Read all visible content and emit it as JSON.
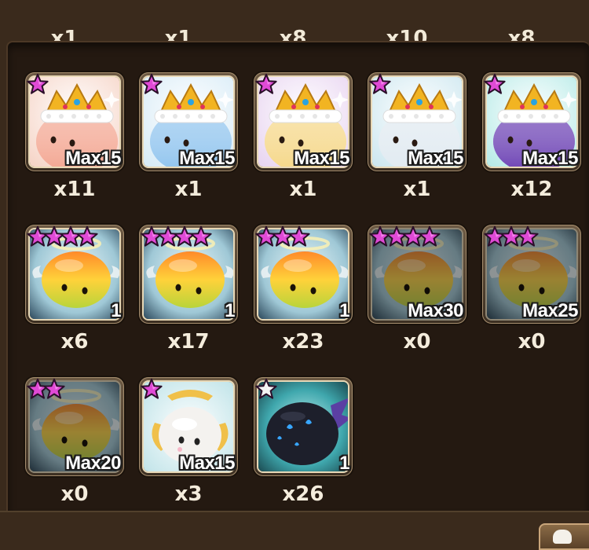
{
  "partial_counts": [
    "x1",
    "x1",
    "x8",
    "x10",
    "x8"
  ],
  "rows": [
    [
      {
        "name": "king-angelmon-fire",
        "stars": 1,
        "star_color": "pink",
        "level": "Max15",
        "qty": "x11",
        "dim": false,
        "kind": "king",
        "body": "#f3a48f",
        "bg": "#f6d6c9"
      },
      {
        "name": "king-angelmon-water",
        "stars": 1,
        "star_color": "pink",
        "level": "Max15",
        "qty": "x1",
        "dim": false,
        "kind": "king",
        "body": "#8ec3ee",
        "bg": "#d9ecf7"
      },
      {
        "name": "king-angelmon-light",
        "stars": 1,
        "star_color": "pink",
        "level": "Max15",
        "qty": "x1",
        "dim": false,
        "kind": "king",
        "body": "#f5d685",
        "bg": "#e9d6f1"
      },
      {
        "name": "king-angelmon-wind",
        "stars": 1,
        "star_color": "pink",
        "level": "Max15",
        "qty": "x1",
        "dim": false,
        "kind": "king",
        "body": "#dfe9f0",
        "bg": "#cfe8f0"
      },
      {
        "name": "king-angelmon-dark",
        "stars": 1,
        "star_color": "pink",
        "level": "Max15",
        "qty": "x12",
        "dim": false,
        "kind": "king",
        "body": "#6a3fb3",
        "bg": "#b9ebe8"
      }
    ],
    [
      {
        "name": "angelmon-4star",
        "stars": 4,
        "star_color": "pink",
        "level": "1",
        "qty": "x6",
        "dim": false,
        "kind": "angel",
        "body": "#f8c240",
        "bg": "#9fc8d6"
      },
      {
        "name": "angelmon-4star-b",
        "stars": 4,
        "star_color": "pink",
        "level": "1",
        "qty": "x17",
        "dim": false,
        "kind": "angel",
        "body": "#f8c240",
        "bg": "#9fc8d6"
      },
      {
        "name": "angelmon-3star",
        "stars": 3,
        "star_color": "pink",
        "level": "1",
        "qty": "x23",
        "dim": false,
        "kind": "angel",
        "body": "#f8c240",
        "bg": "#9fc8d6"
      },
      {
        "name": "angelmon-4star-empty",
        "stars": 4,
        "star_color": "pink",
        "level": "Max30",
        "qty": "x0",
        "dim": true,
        "kind": "angel",
        "body": "#f8c240",
        "bg": "#9fc8d6"
      },
      {
        "name": "angelmon-3star-empty",
        "stars": 3,
        "star_color": "pink",
        "level": "Max25",
        "qty": "x0",
        "dim": true,
        "kind": "angel",
        "body": "#f8c240",
        "bg": "#9fc8d6"
      }
    ],
    [
      {
        "name": "angelmon-2star-empty",
        "stars": 2,
        "star_color": "pink",
        "level": "Max20",
        "qty": "x0",
        "dim": true,
        "kind": "angel",
        "body": "#f8c240",
        "bg": "#9fc8d6"
      },
      {
        "name": "rainbowmon-white",
        "stars": 1,
        "star_color": "pink",
        "level": "Max15",
        "qty": "x3",
        "dim": false,
        "kind": "white",
        "body": "#f4f2ef",
        "bg": "#bfe3e8"
      },
      {
        "name": "devilmon",
        "stars": 1,
        "star_color": "white",
        "level": "1",
        "qty": "x26",
        "dim": false,
        "kind": "devil",
        "body": "#1d1f2b",
        "bg": "#3fa7ad"
      }
    ]
  ]
}
